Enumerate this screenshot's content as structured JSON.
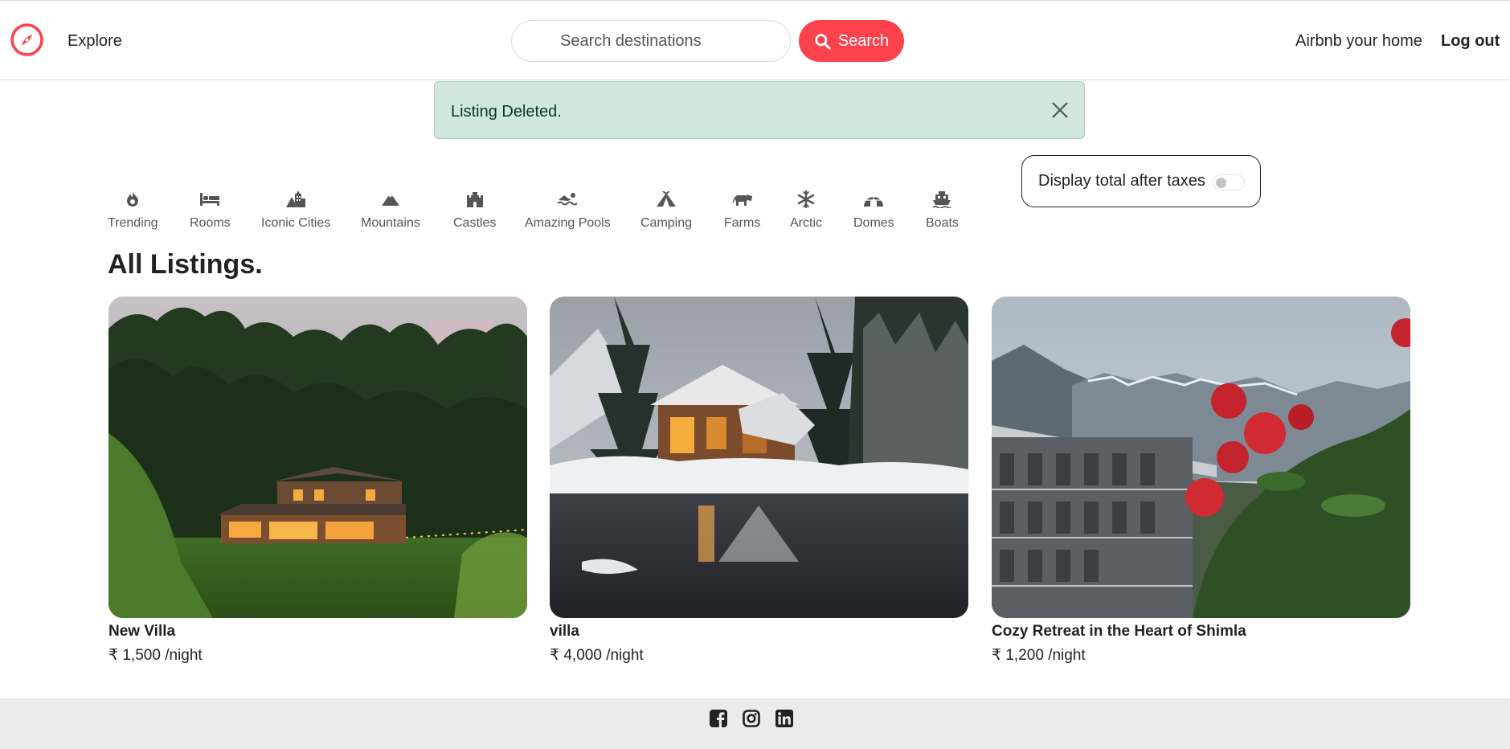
{
  "nav": {
    "explore_label": "Explore",
    "search_placeholder": "Search destinations",
    "search_button_label": "Search",
    "host_label": "Airbnb your home",
    "logout_label": "Log out",
    "brand_color": "#fe424d"
  },
  "alert": {
    "message": "Listing Deleted.",
    "bg_color": "#d1e7dd"
  },
  "filters": [
    {
      "label": "Trending",
      "icon": "fire-icon"
    },
    {
      "label": "Rooms",
      "icon": "bed-icon"
    },
    {
      "label": "Iconic Cities",
      "icon": "city-icon"
    },
    {
      "label": "Mountains",
      "icon": "mountain-icon"
    },
    {
      "label": "Castles",
      "icon": "castle-icon"
    },
    {
      "label": "Amazing Pools",
      "icon": "swimmer-icon"
    },
    {
      "label": "Camping",
      "icon": "tent-icon"
    },
    {
      "label": "Farms",
      "icon": "cow-icon"
    },
    {
      "label": "Arctic",
      "icon": "snowflake-icon"
    },
    {
      "label": "Domes",
      "icon": "igloo-icon"
    },
    {
      "label": "Boats",
      "icon": "ferry-icon"
    }
  ],
  "tax_toggle": {
    "label": "Display total after taxes",
    "checked": false
  },
  "section_title": "All Listings.",
  "listings": [
    {
      "title": "New Villa",
      "price": "₹ 1,500 /night",
      "image": "forest-cabin-photo"
    },
    {
      "title": "villa",
      "price": "₹ 4,000 /night",
      "image": "snow-lodge-lake-photo"
    },
    {
      "title": "Cozy Retreat in the Heart of Shimla",
      "price": "₹ 1,200 /night",
      "image": "mountain-hotel-roses-photo"
    }
  ],
  "footer": {
    "socials": [
      "facebook-icon",
      "instagram-icon",
      "linkedin-icon"
    ]
  }
}
